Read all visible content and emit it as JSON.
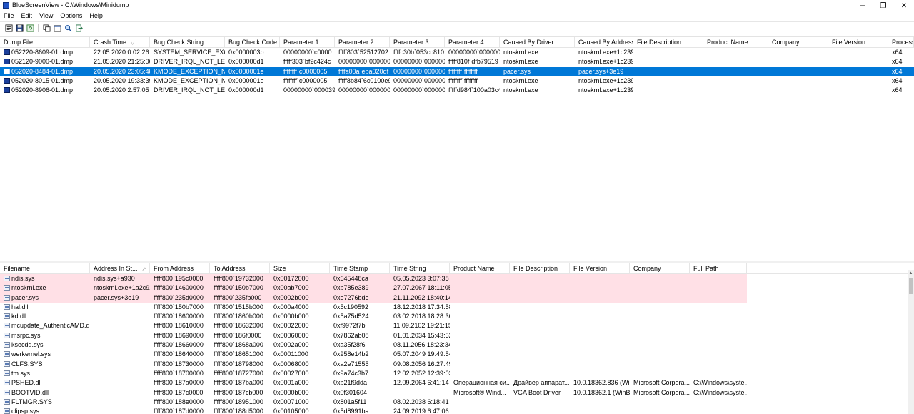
{
  "window": {
    "title": "BlueScreenView  -  C:\\Windows\\Minidump",
    "minimize": "─",
    "maximize": "❐",
    "close": "✕"
  },
  "menu": [
    "File",
    "Edit",
    "View",
    "Options",
    "Help"
  ],
  "toolbar": {
    "icons": [
      "properties-icon",
      "save-icon",
      "refresh-icon",
      "copy-icon",
      "html-report-icon",
      "find-icon",
      "exit-icon"
    ]
  },
  "crash_table": {
    "sort_column": "Crash Time",
    "columns": [
      "Dump File",
      "Crash Time",
      "Bug Check String",
      "Bug Check Code",
      "Parameter 1",
      "Parameter 2",
      "Parameter 3",
      "Parameter 4",
      "Caused By Driver",
      "Caused By Address",
      "File Description",
      "Product Name",
      "Company",
      "File Version",
      "Processor"
    ],
    "selected_row": 2,
    "rows": [
      [
        "052220-8609-01.dmp",
        "22.05.2020 0:02:26",
        "SYSTEM_SERVICE_EXCEP...",
        "0x0000003b",
        "00000000`c0000...",
        "fffff803`52512702",
        "ffffc30b`053cc810",
        "00000000`000000...",
        "ntoskrnl.exe",
        "ntoskrnl.exe+1c2390",
        "",
        "",
        "",
        "",
        "x64"
      ],
      [
        "052120-9000-01.dmp",
        "21.05.2020 21:25:06",
        "DRIVER_IRQL_NOT_LESS...",
        "0x000000d1",
        "fffff303`bf2c424c",
        "00000000`000000...",
        "00000000`000000...",
        "fffff810f`dfb79519",
        "ntoskrnl.exe",
        "ntoskrnl.exe+1c2390",
        "",
        "",
        "",
        "",
        "x64"
      ],
      [
        "052020-8484-01.dmp",
        "20.05.2020 23:05:48",
        "KMODE_EXCEPTION_N...",
        "0x0000001e",
        "ffffffff`c0000005",
        "ffffa00a`eba020df",
        "00000000`000000...",
        "ffffffff`ffffffff",
        "pacer.sys",
        "pacer.sys+3e19",
        "",
        "",
        "",
        "",
        "x64"
      ],
      [
        "052020-8015-01.dmp",
        "20.05.2020 19:33:39",
        "KMODE_EXCEPTION_N...",
        "0x0000001e",
        "ffffffff`c0000005",
        "fffff8b84`6c0100e9",
        "00000000`000000...",
        "ffffffff`ffffffff",
        "ntoskrnl.exe",
        "ntoskrnl.exe+1c2390",
        "",
        "",
        "",
        "",
        "x64"
      ],
      [
        "052020-8906-01.dmp",
        "20.05.2020 2:57:05",
        "DRIVER_IRQL_NOT_LESS...",
        "0x000000d1",
        "00000000`000039...",
        "00000000`000000...",
        "00000000`000000...",
        "fffffd984`100a03c4",
        "ntoskrnl.exe",
        "ntoskrnl.exe+1c2390",
        "",
        "",
        "",
        "",
        "x64"
      ]
    ]
  },
  "driver_table": {
    "sort_column": "Address In St...",
    "columns": [
      "Filename",
      "Address In St...",
      "From Address",
      "To Address",
      "Size",
      "Time Stamp",
      "Time String",
      "Product Name",
      "File Description",
      "File Version",
      "Company",
      "Full Path"
    ],
    "highlighted_rows": [
      0,
      1,
      2
    ],
    "rows": [
      [
        "ndis.sys",
        "ndis.sys+a930",
        "fffff800`195c0000",
        "fffff800`19732000",
        "0x00172000",
        "0x645448ca",
        "05.05.2023 3:07:38",
        "",
        "",
        "",
        "",
        ""
      ],
      [
        "ntoskrnl.exe",
        "ntoskrnl.exe+1a2c92",
        "fffff800`14600000",
        "fffff800`150b7000",
        "0x00ab7000",
        "0xb785e389",
        "27.07.2067 18:11:05",
        "",
        "",
        "",
        "",
        ""
      ],
      [
        "pacer.sys",
        "pacer.sys+3e19",
        "fffff800`235d0000",
        "fffff800`235fb000",
        "0x0002b000",
        "0xe7276bde",
        "21.11.2092 18:40:14",
        "",
        "",
        "",
        "",
        ""
      ],
      [
        "hal.dll",
        "",
        "fffff800`150b7000",
        "fffff800`1515b000",
        "0x000a4000",
        "0x5c190592",
        "18.12.2018 17:34:58",
        "",
        "",
        "",
        "",
        ""
      ],
      [
        "kd.dll",
        "",
        "fffff800`18600000",
        "fffff800`1860b000",
        "0x0000b000",
        "0x5a75d524",
        "03.02.2018 18:28:36",
        "",
        "",
        "",
        "",
        ""
      ],
      [
        "mcupdate_AuthenticAMD.dll",
        "",
        "fffff800`18610000",
        "fffff800`18632000",
        "0x00022000",
        "0xf9972f7b",
        "11.09.2102 19:21:15",
        "",
        "",
        "",
        "",
        ""
      ],
      [
        "msrpc.sys",
        "",
        "fffff800`18690000",
        "fffff800`186f0000",
        "0x00060000",
        "0x7862ab08",
        "01.01.2034 15:43:52",
        "",
        "",
        "",
        "",
        ""
      ],
      [
        "ksecdd.sys",
        "",
        "fffff800`18660000",
        "fffff800`1868a000",
        "0x0002a000",
        "0xa35f28f6",
        "08.11.2056 18:23:34",
        "",
        "",
        "",
        "",
        ""
      ],
      [
        "werkernel.sys",
        "",
        "fffff800`18640000",
        "fffff800`18651000",
        "0x00011000",
        "0x958e14b2",
        "05.07.2049 19:49:54",
        "",
        "",
        "",
        "",
        ""
      ],
      [
        "CLFS.SYS",
        "",
        "fffff800`18730000",
        "fffff800`18798000",
        "0x00068000",
        "0xa2e71555",
        "09.08.2056 16:27:49",
        "",
        "",
        "",
        "",
        ""
      ],
      [
        "tm.sys",
        "",
        "fffff800`18700000",
        "fffff800`18727000",
        "0x00027000",
        "0x9a74c3b7",
        "12.02.2052 12:39:03",
        "",
        "",
        "",
        "",
        ""
      ],
      [
        "PSHED.dll",
        "",
        "fffff800`187a0000",
        "fffff800`187ba000",
        "0x0001a000",
        "0xb21f9dda",
        "12.09.2064 6:41:14",
        "Операционная си...",
        "Драйвер аппарат...",
        "10.0.18362.836 (Wi...",
        "Microsoft Corpora...",
        "C:\\Windows\\syste..."
      ],
      [
        "BOOTVID.dll",
        "",
        "fffff800`187c0000",
        "fffff800`187cb000",
        "0x0000b000",
        "0x0f301604",
        "",
        "Microsoft® Wind...",
        "VGA Boot Driver",
        "10.0.18362.1 (WinB...",
        "Microsoft Corpora...",
        "C:\\Windows\\syste..."
      ],
      [
        "FLTMGR.SYS",
        "",
        "fffff800`188e0000",
        "fffff800`18951000",
        "0x00071000",
        "0x801a5f11",
        "08.02.2038 6:18:41",
        "",
        "",
        "",
        "",
        ""
      ],
      [
        "clipsp.sys",
        "",
        "fffff800`187d0000",
        "fffff800`188d5000",
        "0x00105000",
        "0x5d8991ba",
        "24.09.2019 6:47:06",
        "",
        "",
        "",
        "",
        ""
      ]
    ]
  },
  "scroll": {
    "left_arrow": "◀",
    "right_arrow": "▶",
    "up_arrow": "▲"
  }
}
